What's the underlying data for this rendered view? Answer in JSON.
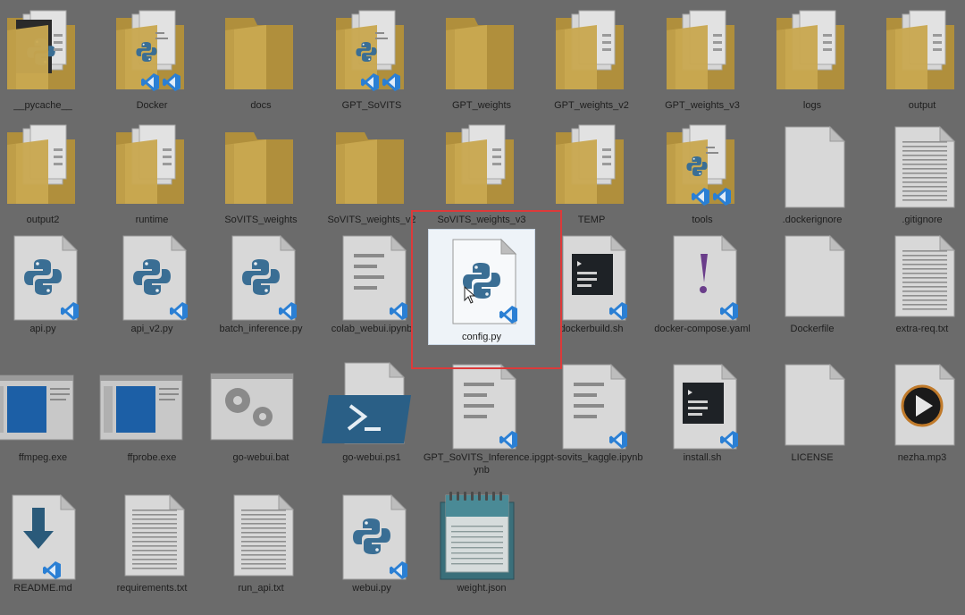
{
  "explorer": {
    "items": [
      {
        "label": "__pycache__",
        "type": "folder-pyc"
      },
      {
        "label": "Docker",
        "type": "folder-code"
      },
      {
        "label": "docs",
        "type": "folder"
      },
      {
        "label": "GPT_SoVITS",
        "type": "folder-code"
      },
      {
        "label": "GPT_weights",
        "type": "folder"
      },
      {
        "label": "GPT_weights_v2",
        "type": "folder-doc"
      },
      {
        "label": "GPT_weights_v3",
        "type": "folder-doc"
      },
      {
        "label": "logs",
        "type": "folder-doc"
      },
      {
        "label": "output",
        "type": "folder-doc"
      },
      {
        "label": "output2",
        "type": "folder-doc"
      },
      {
        "label": "runtime",
        "type": "folder-doc"
      },
      {
        "label": "SoVITS_weights",
        "type": "folder"
      },
      {
        "label": "SoVITS_weights_v2",
        "type": "folder"
      },
      {
        "label": "SoVITS_weights_v3",
        "type": "folder-doc"
      },
      {
        "label": "TEMP",
        "type": "folder-doc"
      },
      {
        "label": "tools",
        "type": "folder-code"
      },
      {
        "label": ".dockerignore",
        "type": "blank"
      },
      {
        "label": ".gitignore",
        "type": "text"
      },
      {
        "label": "api.py",
        "type": "py"
      },
      {
        "label": "api_v2.py",
        "type": "py"
      },
      {
        "label": "batch_inference.py",
        "type": "py"
      },
      {
        "label": "colab_webui.ipynb",
        "type": "lines"
      },
      {
        "label": "config.py",
        "type": "py",
        "selected": true
      },
      {
        "label": "dockerbuild.sh",
        "type": "terminal"
      },
      {
        "label": "docker-compose.yaml",
        "type": "yaml"
      },
      {
        "label": "Dockerfile",
        "type": "blank"
      },
      {
        "label": "extra-req.txt",
        "type": "text"
      },
      {
        "label": "ffmpeg.exe",
        "type": "exe"
      },
      {
        "label": "ffprobe.exe",
        "type": "exe"
      },
      {
        "label": "go-webui.bat",
        "type": "bat"
      },
      {
        "label": "go-webui.ps1",
        "type": "ps1"
      },
      {
        "label": "GPT_SoVITS_Inference.ipynb",
        "type": "lines"
      },
      {
        "label": "gpt-sovits_kaggle.ipynb",
        "type": "lines"
      },
      {
        "label": "install.sh",
        "type": "terminal"
      },
      {
        "label": "LICENSE",
        "type": "blank"
      },
      {
        "label": "nezha.mp3",
        "type": "media"
      },
      {
        "label": "README.md",
        "type": "md"
      },
      {
        "label": "requirements.txt",
        "type": "text"
      },
      {
        "label": "run_api.txt",
        "type": "text"
      },
      {
        "label": "webui.py",
        "type": "py"
      },
      {
        "label": "weight.json",
        "type": "notepad"
      }
    ]
  },
  "colors": {
    "folder": "#c9a850",
    "folder_dark": "#b08f3c",
    "python_blue": "#3a6e94",
    "python_yellow": "#d9c04a",
    "vscode_blue": "#2a7fd4",
    "highlight_red": "#dd3a3a"
  }
}
